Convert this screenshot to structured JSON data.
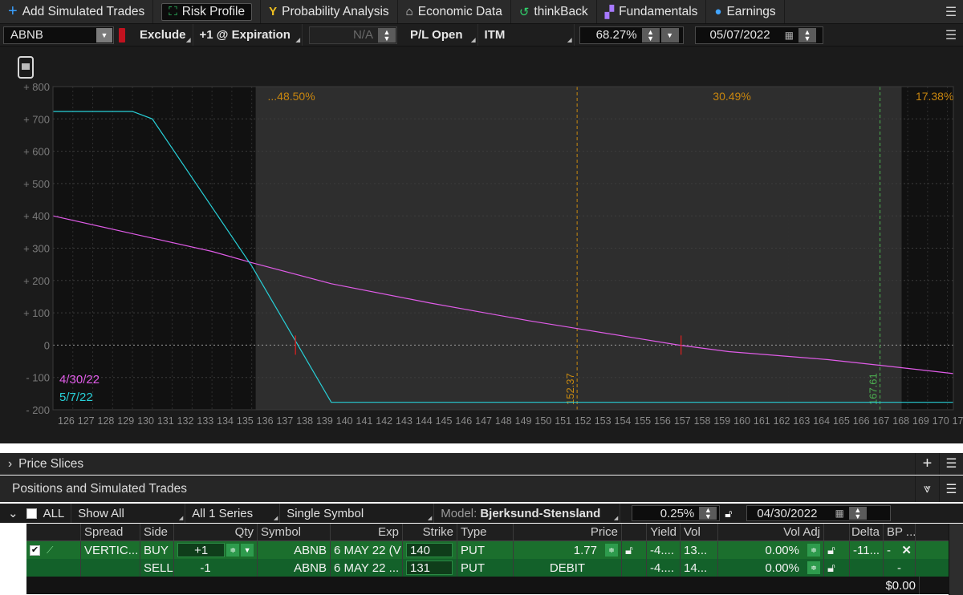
{
  "tabs": [
    {
      "label": "Add Simulated Trades",
      "icon": "plus-icon",
      "icon_char": "+",
      "color": "#3aa0ff"
    },
    {
      "label": "Risk Profile",
      "icon": "risk-chart-icon",
      "icon_char": "⛶",
      "color": "#31d06b"
    },
    {
      "label": "Probability Analysis",
      "icon": "probability-icon",
      "icon_char": "Y",
      "color": "#f0c020"
    },
    {
      "label": "Economic Data",
      "icon": "bank-icon",
      "icon_char": "⌂",
      "color": "#d8d8d8"
    },
    {
      "label": "thinkBack",
      "icon": "history-icon",
      "icon_char": "↺",
      "color": "#31d06b"
    },
    {
      "label": "Fundamentals",
      "icon": "fundamentals-icon",
      "icon_char": "▞",
      "color": "#a779ff"
    },
    {
      "label": "Earnings",
      "icon": "lightbulb-icon",
      "icon_char": "●",
      "color": "#42a5ff"
    }
  ],
  "controls": {
    "symbol": "ABNB",
    "exclude_label": "Exclude",
    "expiration_label": "+1 @ Expiration",
    "na_value": "N/A",
    "pl_open_label": "P/L Open",
    "itm_label": "ITM",
    "percent_value": "68.27%",
    "date_value": "05/07/2022"
  },
  "chart_data": {
    "type": "line",
    "x_ticks": [
      "126",
      "127",
      "128",
      "129",
      "130",
      "131",
      "132",
      "133",
      "134",
      "135",
      "136",
      "137",
      "138",
      "139",
      "140",
      "141",
      "142",
      "143",
      "144",
      "145",
      "146",
      "147",
      "148",
      "149",
      "150",
      "151",
      "152",
      "153",
      "154",
      "155",
      "156",
      "157",
      "158",
      "159",
      "160",
      "161",
      "162",
      "163",
      "164",
      "165",
      "166",
      "167",
      "168",
      "169",
      "170",
      "17"
    ],
    "y_ticks": [
      "+ 800",
      "+ 700",
      "+ 600",
      "+ 500",
      "+ 400",
      "+ 300",
      "+ 200",
      "+ 100",
      "0",
      "- 100",
      "- 200"
    ],
    "xlim": [
      126,
      171.3
    ],
    "ylim": [
      -200,
      800
    ],
    "series": [
      {
        "name": "4/30/22",
        "color": "#e05ce8",
        "points": [
          [
            126,
            400
          ],
          [
            130,
            345
          ],
          [
            134,
            290
          ],
          [
            136,
            255
          ],
          [
            140,
            190
          ],
          [
            145,
            130
          ],
          [
            150,
            75
          ],
          [
            152,
            55
          ],
          [
            155,
            25
          ],
          [
            157.5,
            0
          ],
          [
            160,
            -20
          ],
          [
            165,
            -45
          ],
          [
            168,
            -65
          ],
          [
            171.3,
            -88
          ]
        ]
      },
      {
        "name": "5/7/22",
        "color": "#28d0d8",
        "points": [
          [
            126,
            723
          ],
          [
            130,
            723
          ],
          [
            131,
            700
          ],
          [
            136,
            245
          ],
          [
            140,
            -177
          ],
          [
            171.3,
            -177
          ]
        ]
      }
    ],
    "band_labels": [
      "...48.50%",
      "30.49%",
      "17.38%"
    ],
    "vlines": [
      {
        "x": 152.37,
        "label": "152.37",
        "color": "#c88a10"
      },
      {
        "x": 167.61,
        "label": "167.61",
        "color": "#4caf50"
      }
    ],
    "markers": [
      {
        "x": 138.2,
        "y": 0
      },
      {
        "x": 157.6,
        "y": 0
      }
    ],
    "grid": true,
    "legend_position": "bottom-left"
  },
  "sections": {
    "price_slices": "Price Slices",
    "positions": "Positions and Simulated Trades"
  },
  "filters": {
    "all": "ALL",
    "show_all": "Show All",
    "series": "All 1 Series",
    "single_symbol": "Single Symbol",
    "model_label": "Model:",
    "model_value": "Bjerksund-Stensland",
    "rate": "0.25%",
    "date": "04/30/2022"
  },
  "table": {
    "headers": [
      "Spread",
      "Side",
      "Qty",
      "Symbol",
      "Exp",
      "Strike",
      "Type",
      "Price",
      "Yield",
      "Vol",
      "Vol Adj",
      "Delta",
      "BP ..."
    ],
    "rows": [
      {
        "spread": "VERTIC...",
        "side": "BUY",
        "qty": "+1",
        "symbol": "ABNB",
        "exp": "6 MAY 22 (V",
        "strike": "140",
        "type": "PUT",
        "price": "1.77",
        "yield": "-4....",
        "vol": "13...",
        "vol_adj": "0.00%",
        "delta": "-11...",
        "bp": "-"
      },
      {
        "spread": "",
        "side": "SELL",
        "qty": "-1",
        "symbol": "ABNB",
        "exp": "6 MAY 22 ...",
        "strike": "131",
        "type": "PUT",
        "price": "DEBIT",
        "yield": "-4....",
        "vol": "14...",
        "vol_adj": "0.00%",
        "delta": "",
        "bp": "-"
      }
    ],
    "total_bp": "$0.00"
  }
}
